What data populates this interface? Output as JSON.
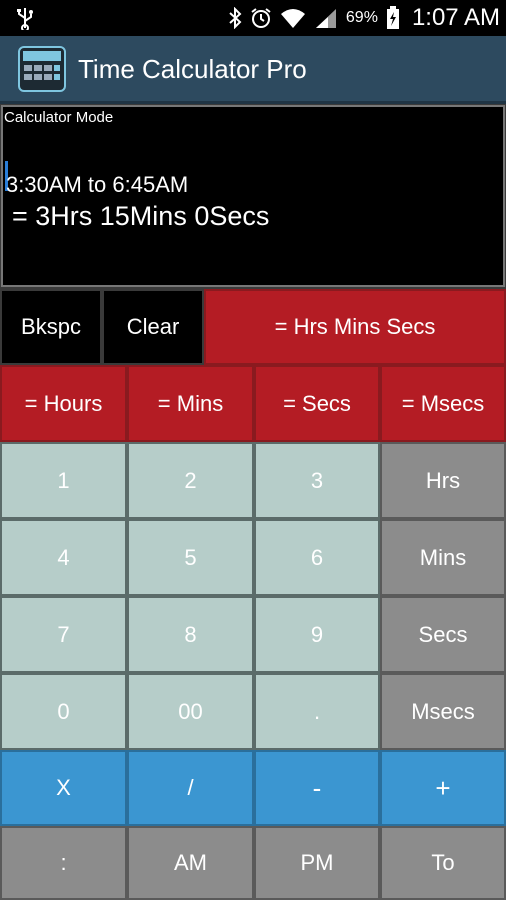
{
  "status_bar": {
    "battery_pct": "69%",
    "time": "1:07 AM"
  },
  "app_bar": {
    "title": "Time Calculator Pro"
  },
  "display": {
    "mode_label": "Calculator Mode",
    "expression": "3:30AM to 6:45AM",
    "result": " = 3Hrs 15Mins 0Secs"
  },
  "controls": {
    "bkspc": "Bkspc",
    "clear": "Clear",
    "eq_hrs_mins_secs": "= Hrs Mins Secs"
  },
  "conversions": [
    "= Hours",
    "= Mins",
    "= Secs",
    "= Msecs"
  ],
  "keypad": {
    "rows": [
      [
        "1",
        "2",
        "3",
        "Hrs"
      ],
      [
        "4",
        "5",
        "6",
        "Mins"
      ],
      [
        "7",
        "8",
        "9",
        "Secs"
      ],
      [
        "0",
        "00",
        ".",
        "Msecs"
      ]
    ],
    "operators": [
      "X",
      "/",
      "-",
      "+"
    ],
    "bottom": [
      ":",
      "AM",
      "PM",
      "To"
    ]
  },
  "colors": {
    "app_bar": "#2d4a5f",
    "red_buttons": "#b41c24",
    "digit_keys": "#b6cdc9",
    "unit_keys": "#8c8c8c",
    "operator_keys": "#3b96d1"
  }
}
